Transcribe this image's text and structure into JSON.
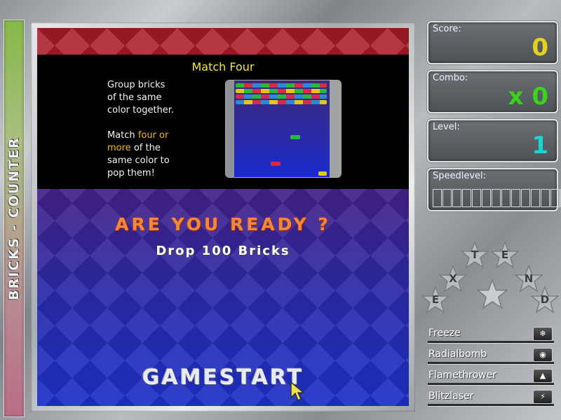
{
  "game": {
    "side_title": "BRICKS - COUNTER"
  },
  "tutorial": {
    "title": "Match Four",
    "line1": "Group bricks",
    "line2": "of the same",
    "line3": "color together.",
    "line4a": "Match ",
    "line4b": "four or",
    "line5a": "more",
    "line5b": " of the",
    "line6": "same color to",
    "line7": "pop them!"
  },
  "prompt": {
    "ready": "ARE YOU READY ?",
    "goal": "Drop 100 Bricks",
    "start": "GAMESTART"
  },
  "stats": {
    "score_label": "Score:",
    "score_value": "0",
    "combo_label": "Combo:",
    "combo_value": "x 0",
    "level_label": "Level:",
    "level_value": "1",
    "speed_label": "Speedlevel:",
    "speed_level": 0,
    "speed_cells": 15
  },
  "extend": {
    "letters": [
      "E",
      "X",
      "T",
      "E",
      "N",
      "D"
    ]
  },
  "powerups": [
    {
      "label": "Freeze",
      "icon": "snowflake-icon"
    },
    {
      "label": "Radialbomb",
      "icon": "bomb-icon"
    },
    {
      "label": "Flamethrower",
      "icon": "flame-icon"
    },
    {
      "label": "Blitzlaser",
      "icon": "lightning-icon"
    }
  ],
  "colors": {
    "score": "#e6d21a",
    "combo": "#3ad21a",
    "level": "#1ad2d2",
    "accent": "#f5e82a"
  }
}
